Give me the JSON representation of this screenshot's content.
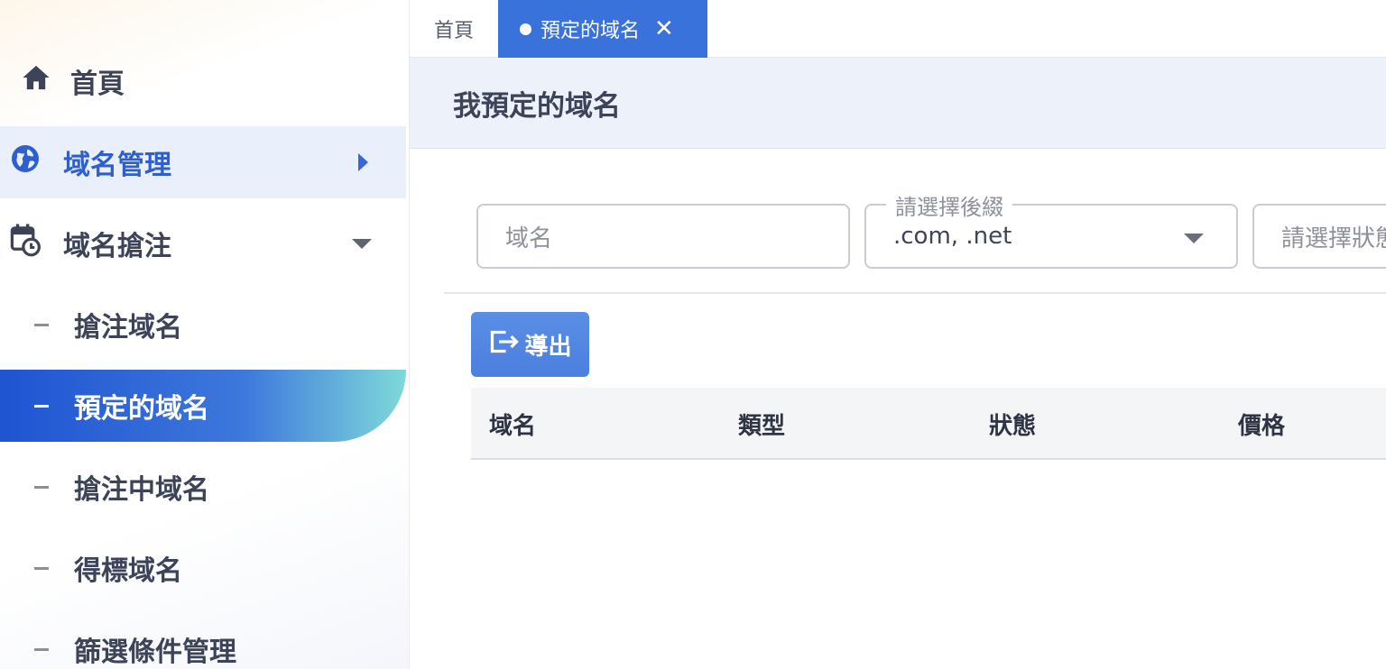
{
  "sidebar": {
    "home_label": "首頁",
    "domain_mgmt_label": "域名管理",
    "domain_grab_label": "域名搶注",
    "sub_items": [
      {
        "label": "搶注域名"
      },
      {
        "label": "預定的域名"
      },
      {
        "label": "搶注中域名"
      },
      {
        "label": "得標域名"
      },
      {
        "label": "篩選條件管理"
      }
    ],
    "active_sub_item": "預定的域名"
  },
  "tabs": {
    "home_label": "首頁",
    "active_label": "預定的域名"
  },
  "page": {
    "title": "我預定的域名"
  },
  "filters": {
    "domain_placeholder": "域名",
    "suffix_label": "請選擇後綴",
    "suffix_value": ".com, .net",
    "status_placeholder": "請選擇狀態"
  },
  "toolbar": {
    "export_label": "導出"
  },
  "table": {
    "columns": [
      "域名",
      "類型",
      "狀態",
      "價格"
    ]
  },
  "colors": {
    "accent": "#3a72dc",
    "active_menu_gradient_start": "#1f54d2",
    "active_menu_gradient_end": "#7fd9d9",
    "header_bg": "#edf1f9"
  }
}
